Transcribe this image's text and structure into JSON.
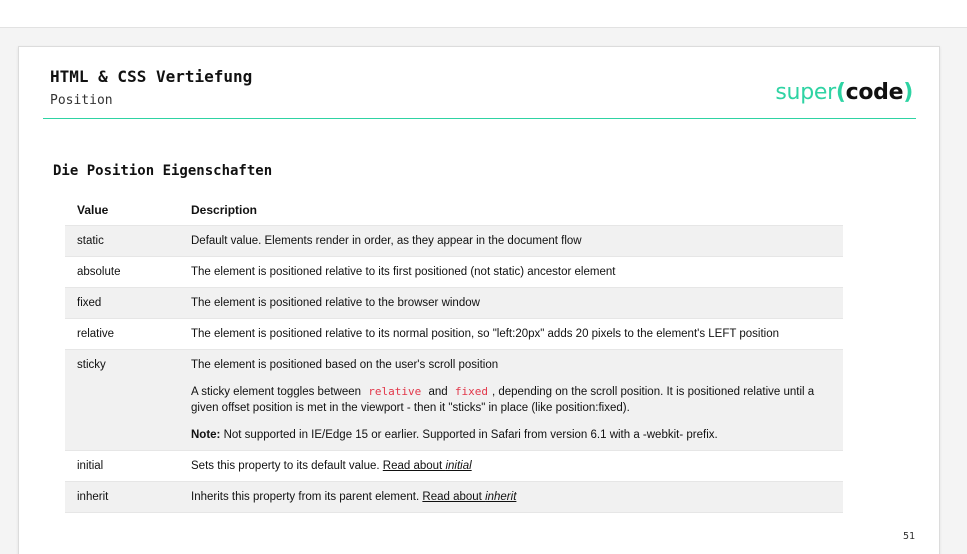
{
  "header": {
    "title": "HTML & CSS Vertiefung",
    "subtitle": "Position",
    "logo": {
      "part1": "super",
      "part2": "(",
      "part3": "code",
      "part4": ")"
    }
  },
  "section_title": "Die Position Eigenschaften",
  "table": {
    "headers": {
      "value": "Value",
      "description": "Description"
    },
    "rows": {
      "static": {
        "value": "static",
        "description": "Default value. Elements render in order, as they appear in the document flow"
      },
      "absolute": {
        "value": "absolute",
        "description": "The element is positioned relative to its first positioned (not static) ancestor element"
      },
      "fixed": {
        "value": "fixed",
        "description": "The element is positioned relative to the browser window"
      },
      "relative": {
        "value": "relative",
        "description": "The element is positioned relative to its normal position, so \"left:20px\" adds 20 pixels to the element's LEFT position"
      },
      "sticky": {
        "value": "sticky",
        "p1": "The element is positioned based on the user's scroll position",
        "p2_pre": "A sticky element toggles between",
        "p2_code1": "relative",
        "p2_and": "and",
        "p2_code2": "fixed",
        "p2_post": ", depending on the scroll position. It is positioned relative until a given offset position is met in the viewport - then it \"sticks\" in place (like position:fixed).",
        "note_label": "Note:",
        "note_text": " Not supported in IE/Edge 15 or earlier. Supported in Safari from version 6.1 with a -webkit- prefix."
      },
      "initial": {
        "value": "initial",
        "description": "Sets this property to its default value.",
        "link_text": "Read about ",
        "link_em": "initial"
      },
      "inherit": {
        "value": "inherit",
        "description": "Inherits this property from its parent element.",
        "link_text": "Read about ",
        "link_em": "inherit"
      }
    }
  },
  "page_number": "51",
  "colors": {
    "accent": "#2ed3a3",
    "code_red": "#e2374a",
    "row_alt": "#f1f1f1"
  }
}
